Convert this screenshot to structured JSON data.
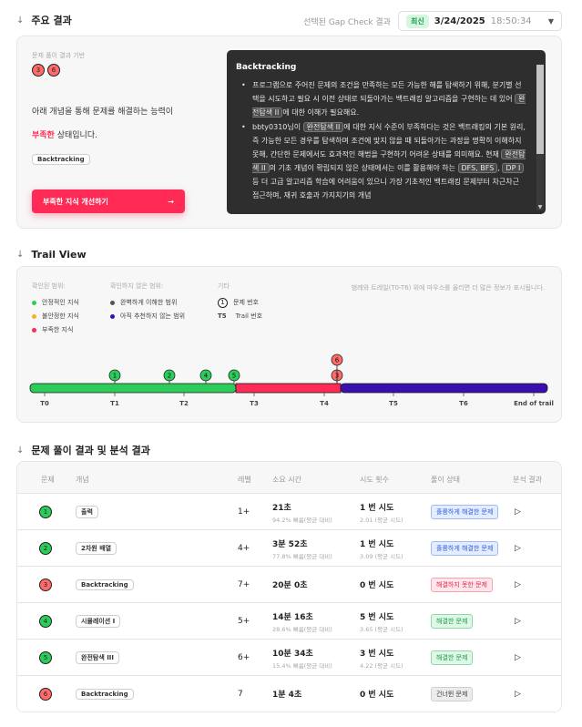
{
  "summary": {
    "title": "주요 결과",
    "gap_label": "선택된 Gap Check 결과",
    "gap_badge": "최신",
    "gap_date": "3/24/2025",
    "gap_time": "18:50:34",
    "basis_label": "문제 풀이 결과 기반",
    "basis_problems": [
      "3",
      "6"
    ],
    "ability_text": "아래 개념을 통해 문제를 해결하는 능력이",
    "state_emph": "부족한",
    "state_rest": " 상태입니다.",
    "concept_tag": "Backtracking",
    "improve_button": "부족한 지식 개선하기",
    "improve_arrow": "→",
    "tooltip": {
      "title": "Backtracking",
      "p1_a": "프로그램으로 주어진 문제의 조건을 만족하는 모든 가능한 해를 탐색하기 위해, 분기별 선택을 시도하고 필요 시 이전 상태로 되돌아가는 백트래킹 알고리즘을 구현하는 데 있어 ",
      "p1_code": "완전탐색 II",
      "p1_b": "에 대한 이해가 필요해요.",
      "p2_a": "bbty0310님이 ",
      "p2_code1": "완전탐색 II",
      "p2_b": "에 대한 지식 수준이 부족하다는 것은 백트래킹의 기본 원리, 즉 가능한 모든 경우를 탐색하며 조건에 맞지 않을 때 되돌아가는 과정을 명확히 이해하지 못해, 간단한 문제에서도 효과적인 해법을 구현하기 어려운 상태를 의미해요. 현재 ",
      "p2_code2": "완전탐색 II",
      "p2_c": "의 기초 개념이 확립되지 않은 상태에서는 이를 활용해야 하는 ",
      "p2_code3": "DFS, BFS",
      "p2_d": ", ",
      "p2_code4": "DP I",
      "p2_e": " 등 더 고급 알고리즘 학습에 어려움이 있으니 가장 기초적인 백트래킹 문제부터 차근차근 접근하며, 재귀 호출과 가지치기의 개념"
    }
  },
  "trail": {
    "title": "Trail View",
    "hint": "범례와 트레일(T0-T6) 위에 마우스를 올리면 더 많은 정보가 표시됩니다.",
    "legend_confirmed": {
      "label": "확인된 범위:",
      "items": [
        {
          "label": "안정적인 지식",
          "color": "#2ccc5a"
        },
        {
          "label": "불안정한 지식",
          "color": "#ffb020"
        },
        {
          "label": "부족한 지식",
          "color": "#ff2a55"
        }
      ]
    },
    "legend_unconfirmed": {
      "label": "확인하지 않은 범위:",
      "items": [
        {
          "label": "완벽하게 이해한 범위",
          "color": "#555555"
        },
        {
          "label": "아직 추천하지 않는 범위",
          "color": "#3a0fb0"
        }
      ]
    },
    "legend_other": {
      "label": "기타",
      "problem_label": "문제 번호",
      "trail_code": "T5",
      "trail_label": "Trail 번호"
    },
    "ticks": [
      "T0",
      "T1",
      "T2",
      "T3",
      "T4",
      "T5",
      "T6",
      "End of trail"
    ],
    "green_markers": [
      "1",
      "2",
      "4",
      "5"
    ],
    "red_markers": [
      "3",
      "6"
    ]
  },
  "results": {
    "title": "문제 풀이 결과 및 분석 결과",
    "headers": [
      "문제",
      "개념",
      "레벨",
      "소요 시간",
      "시도 횟수",
      "풀이 상태",
      "분석 결과"
    ],
    "rows": [
      {
        "num": "1",
        "color": "green",
        "concept": "출력",
        "level": "1+",
        "time": "21초",
        "time_sub": "94.2% 빠름(평균 대비)",
        "tries": "1 번 시도",
        "tries_sub": "2.01 (평균 시도)",
        "status": "훌륭하게 해결한 문제",
        "status_type": "blue"
      },
      {
        "num": "2",
        "color": "green",
        "concept": "2차원 배열",
        "level": "4+",
        "time": "3분 52초",
        "time_sub": "77.8% 빠름(평균 대비)",
        "tries": "1 번 시도",
        "tries_sub": "3.09 (평균 시도)",
        "status": "훌륭하게 해결한 문제",
        "status_type": "blue"
      },
      {
        "num": "3",
        "color": "red",
        "concept": "Backtracking",
        "level": "7+",
        "time": "20분 0초",
        "time_sub": "",
        "tries": "0 번 시도",
        "tries_sub": "",
        "status": "해결하지 못한 문제",
        "status_type": "red"
      },
      {
        "num": "4",
        "color": "green",
        "concept": "시뮬레이션 I",
        "level": "5+",
        "time": "14분 16초",
        "time_sub": "28.6% 빠름(평균 대비)",
        "tries": "5 번 시도",
        "tries_sub": "3.65 (평균 시도)",
        "status": "해결한 문제",
        "status_type": "green"
      },
      {
        "num": "5",
        "color": "green",
        "concept": "완전탐색 III",
        "level": "6+",
        "time": "10분 34초",
        "time_sub": "15.4% 빠름(평균 대비)",
        "tries": "3 번 시도",
        "tries_sub": "4.22 (평균 시도)",
        "status": "해결한 문제",
        "status_type": "green"
      },
      {
        "num": "6",
        "color": "red",
        "concept": "Backtracking",
        "level": "7",
        "time": "1분 4초",
        "time_sub": "",
        "tries": "0 번 시도",
        "tries_sub": "",
        "status": "건너뛴 문제",
        "status_type": "gray"
      }
    ]
  }
}
